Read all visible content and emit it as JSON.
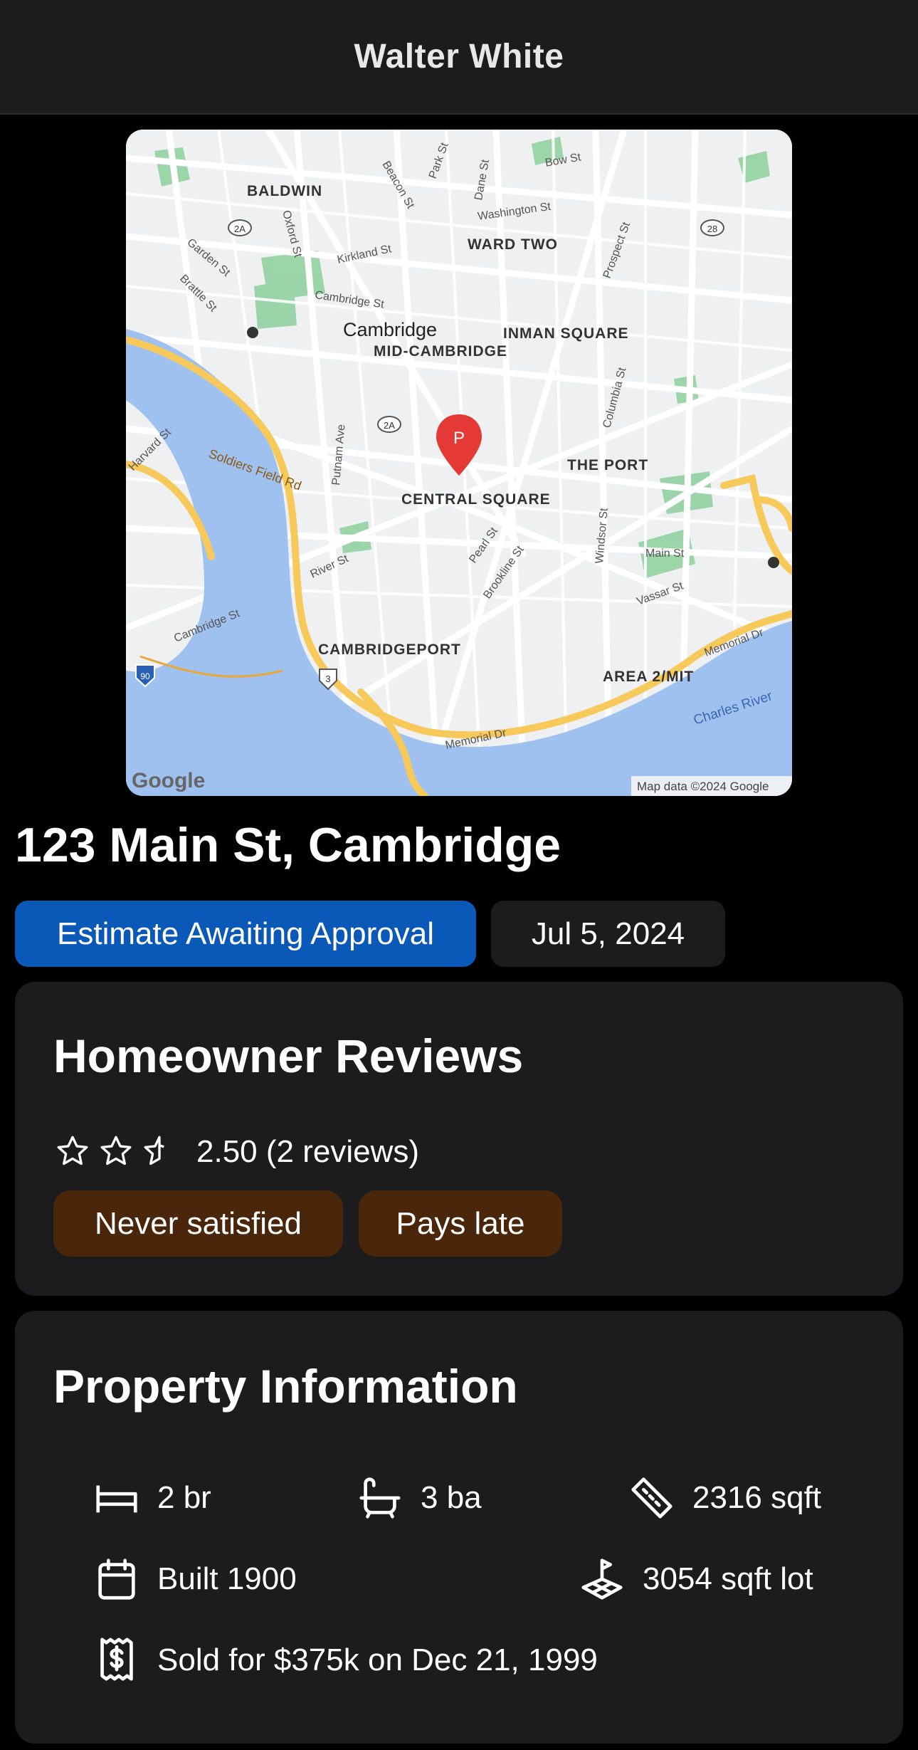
{
  "header": {
    "title": "Walter White"
  },
  "map": {
    "labels": {
      "baldwin": "BALDWIN",
      "ward_two": "WARD TWO",
      "cambridge": "Cambridge",
      "mid_cambridge": "MID-CAMBRIDGE",
      "inman_square": "INMAN SQUARE",
      "the_port": "THE PORT",
      "central_square": "CENTRAL SQUARE",
      "cambridgeport": "CAMBRIDGEPORT",
      "area2_mit": "AREA 2/MIT",
      "charles_river": "Charles River",
      "memorial_dr": "Memorial Dr",
      "memorial_dr_2": "Memorial Dr",
      "soldiers_field": "Soldiers Field Rd",
      "river_st": "River St",
      "cambridge_st": "Cambridge St",
      "cambridge_st_2": "Cambridge St",
      "main_st": "Main St",
      "vassar_st": "Vassar St",
      "putnam_ave": "Putnam Ave",
      "pearl_st": "Pearl St",
      "brookline_st": "Brookline St",
      "windsor_st": "Windsor St",
      "columbia_st": "Columbia St",
      "prospect_st": "Prospect St",
      "kirkland_st": "Kirkland St",
      "washington_st": "Washington St",
      "beacon_st": "Beacon St",
      "park_st": "Park St",
      "dane_st": "Dane St",
      "bow_st": "Bow St",
      "oxford_st": "Oxford St",
      "garden_st": "Garden St",
      "brattle_st": "Brattle St",
      "harvard_st": "Harvard St",
      "route_2a": "2A",
      "route_2a_2": "2A",
      "route_2a_3": "2A",
      "route_28": "28",
      "route_3": "3",
      "route_90": "90",
      "pin": "P",
      "google": "Google",
      "attribution": "Map data ©2024 Google"
    }
  },
  "property": {
    "address": "123 Main St, Cambridge",
    "status": "Estimate Awaiting Approval",
    "date": "Jul 5, 2024"
  },
  "reviews": {
    "title": "Homeowner Reviews",
    "rating": 2.5,
    "max_rating": 3,
    "rating_text": "2.50 (2 reviews)",
    "tags": [
      "Never satisfied",
      "Pays late"
    ]
  },
  "property_info": {
    "title": "Property Information",
    "bedrooms": "2 br",
    "bathrooms": "3 ba",
    "area": "2316 sqft",
    "built": "Built 1900",
    "lot": "3054 sqft lot",
    "sale": "Sold for $375k on Dec 21, 1999"
  },
  "icons": {
    "bed": "bed-icon",
    "bath": "bathtub-icon",
    "ruler": "ruler-icon",
    "calendar": "calendar-icon",
    "lot": "lot-icon",
    "receipt": "receipt-icon",
    "pin": "map-pin-icon"
  },
  "colors": {
    "status_pill": "#0a58b8",
    "tag": "#4a260b",
    "card": "#1c1c1e",
    "river": "#9fc1f0",
    "highway": "#f7c85a",
    "park": "#92d1a0",
    "pin": "#e53935"
  }
}
